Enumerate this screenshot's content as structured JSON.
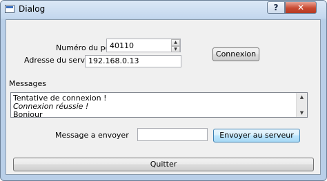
{
  "window": {
    "title": "Dialog",
    "help_label": "?",
    "close_label": "✕"
  },
  "form": {
    "port_label": "Numéro du port",
    "port_value": "40110",
    "address_label": "Adresse du serveur",
    "address_value": "192.168.0.13",
    "connect_button": "Connexion",
    "messages_label": "Messages",
    "messages": [
      "Tentative de connexion !",
      "Connexion réussie !",
      "Bonjour"
    ],
    "send_label": "Message a envoyer",
    "send_value": "",
    "send_button": "Envoyer au serveur",
    "quit_button": "Quitter"
  },
  "icons": {
    "spin_up": "▲",
    "spin_down": "▼",
    "scroll_up": "▲",
    "scroll_down": "▼"
  }
}
